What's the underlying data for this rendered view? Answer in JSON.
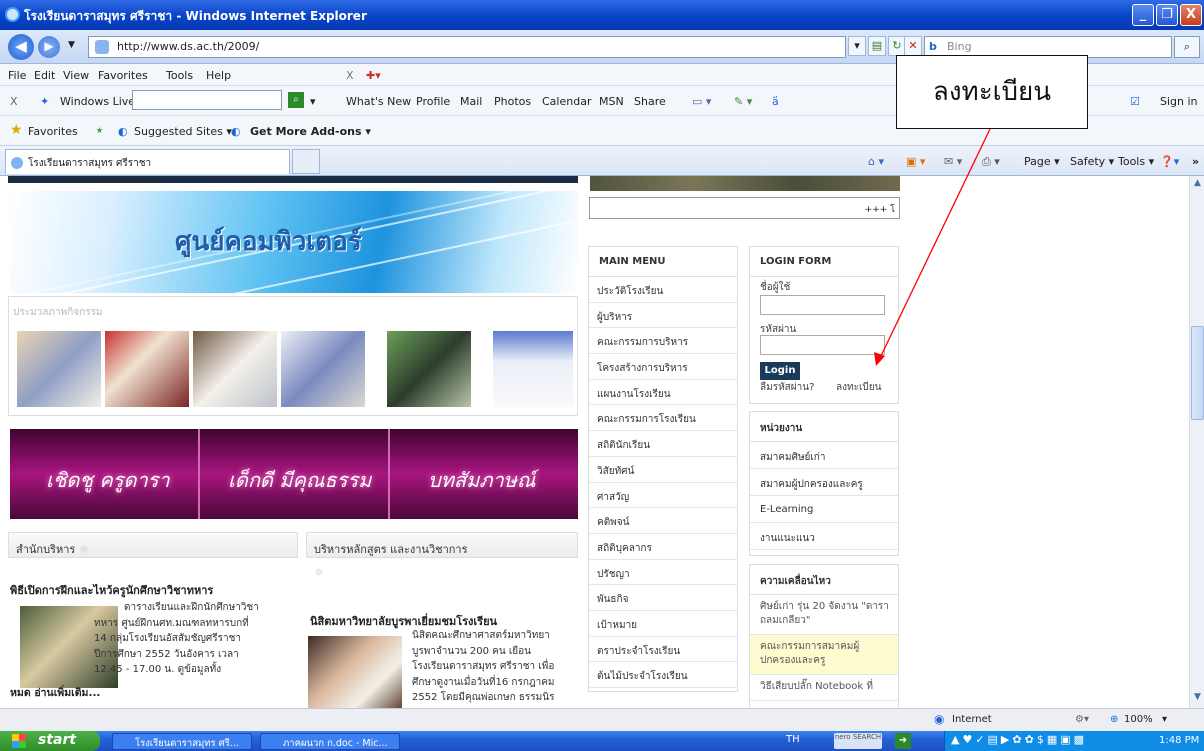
{
  "window": {
    "title": "โรงเรียนดาราสมุทร ศรีราชา - Windows Internet Explorer",
    "min": "_",
    "max": "❐",
    "close": "X"
  },
  "address": {
    "url": "http://www.ds.ac.th/2009/",
    "search_placeholder": "Bing",
    "search_brand": "b"
  },
  "menu": {
    "items": [
      "File",
      "Edit",
      "View",
      "Favorites",
      "Tools",
      "Help"
    ],
    "close": "X"
  },
  "windows_live": {
    "close": "X",
    "label": "Windows Live",
    "items": [
      "What's New",
      "Profile",
      "Mail",
      "Photos",
      "Calendar",
      "MSN",
      "Share"
    ],
    "sign_in": "Sign in"
  },
  "favorites": {
    "label": "Favorites",
    "suggested": "Suggested Sites ▾",
    "addons": "Get More Add-ons ▾"
  },
  "tab": {
    "label": "โรงเรียนดาราสมุทร ศรีราชา"
  },
  "commandbar": {
    "page": "Page ▾",
    "safety": "Safety ▾",
    "tools": "Tools ▾"
  },
  "callout": {
    "text": "ลงทะเบียน",
    "color": "#ff0000"
  },
  "site": {
    "marquee": "+++ โ",
    "banner_title": "ศูนย์คอมพิวเตอร์",
    "activity_label": "ประมวลภาพกิจกรรม",
    "ribbon": [
      "เชิดชู ครูดารา",
      "เด็กดี มีคุณธรรม",
      "บทสัมภาษณ์"
    ],
    "main_menu": {
      "title": "MAIN MENU",
      "items": [
        "ประวัติโรงเรียน",
        "ผู้บริหาร",
        "คณะกรรมการบริหาร",
        "โครงสร้างการบริหาร",
        "แผนงานโรงเรียน",
        "คณะกรรมการโรงเรียน",
        "สถิตินักเรียน",
        "วิสัยทัศน์",
        "ศาสวัญ",
        "คติพจน์",
        "สถิติบุคลากร",
        "ปรัชญา",
        "พันธกิจ",
        "เป้าหมาย",
        "ตราประจำโรงเรียน",
        "ต้นไม้ประจำโรงเรียน"
      ]
    },
    "login": {
      "title": "LOGIN FORM",
      "username_label": "ชื่อผู้ใช้",
      "password_label": "รหัสผ่าน",
      "button": "Login",
      "forgot": "ลืมรหัสผ่าน?",
      "register": "ลงทะเบียน"
    },
    "units": {
      "title": "หน่วยงาน",
      "items": [
        "สมาคมศิษย์เก่า",
        "สมาคมผู้ปกครองและครู",
        "E-Learning",
        "งานแนะแนว"
      ]
    },
    "news_box": {
      "title": "ความเคลื่อนไหว",
      "items": [
        "ศิษย์เก่า รุ่น 20 จัดงาน \"ดาราถลมเกลียว\"",
        "คณะกรรมการสมาคมผู้ปกครองและครู",
        "วิธีเสียบปลั๊ก Notebook ที่"
      ]
    },
    "admin_section": {
      "title": "สำนักบริหาร",
      "headline": "พิธีเปิดการฝึกและไหว้ครูนักศึกษาวิชาทหาร",
      "lines": [
        "ดารางเรียนและฝึกนักศึกษาวิชา",
        "ทหาร ศูนย์ฝึกนศท.มณฑลทหารบกที่",
        "14 กลุ่มโรงเรียนอัสสัมชัญศรีราชา",
        "ปีการศึกษา 2552 วันอังคาร เวลา",
        "12.45 - 17.00 น. ดูข้อมูลทั้ง"
      ],
      "more": "หมด อ่านเพิ่มเติม..."
    },
    "curriculum_section": {
      "title": "บริหารหลักสูตร และงานวิชาการ",
      "headline": "นิสิตมหาวิทยาลัยบูรพาเยี่ยมชมโรงเรียน",
      "lines": [
        "นิสิตคณะศึกษาศาสตร์มหาวิทยา",
        "บูรพาจำนวน 200 คน เยือน",
        "โรงเรียนดาราสมุทร ศรีราชา เพื่อ",
        "ศึกษาดูงานเมื่อวันที่16 กรกฎาคม",
        "2552 โดยมีคุณพ่อเกษก ธรรมนิร"
      ]
    }
  },
  "status": {
    "zone": "Internet",
    "zoom": "100%"
  },
  "taskbar": {
    "start": "start",
    "tasks": [
      "โรงเรียนดาราสมุทร ศรี...",
      "ภาคผนวก ก.doc - Mic..."
    ],
    "lang": "TH",
    "nero": "nero SEARCH",
    "clock": "1:48 PM"
  }
}
